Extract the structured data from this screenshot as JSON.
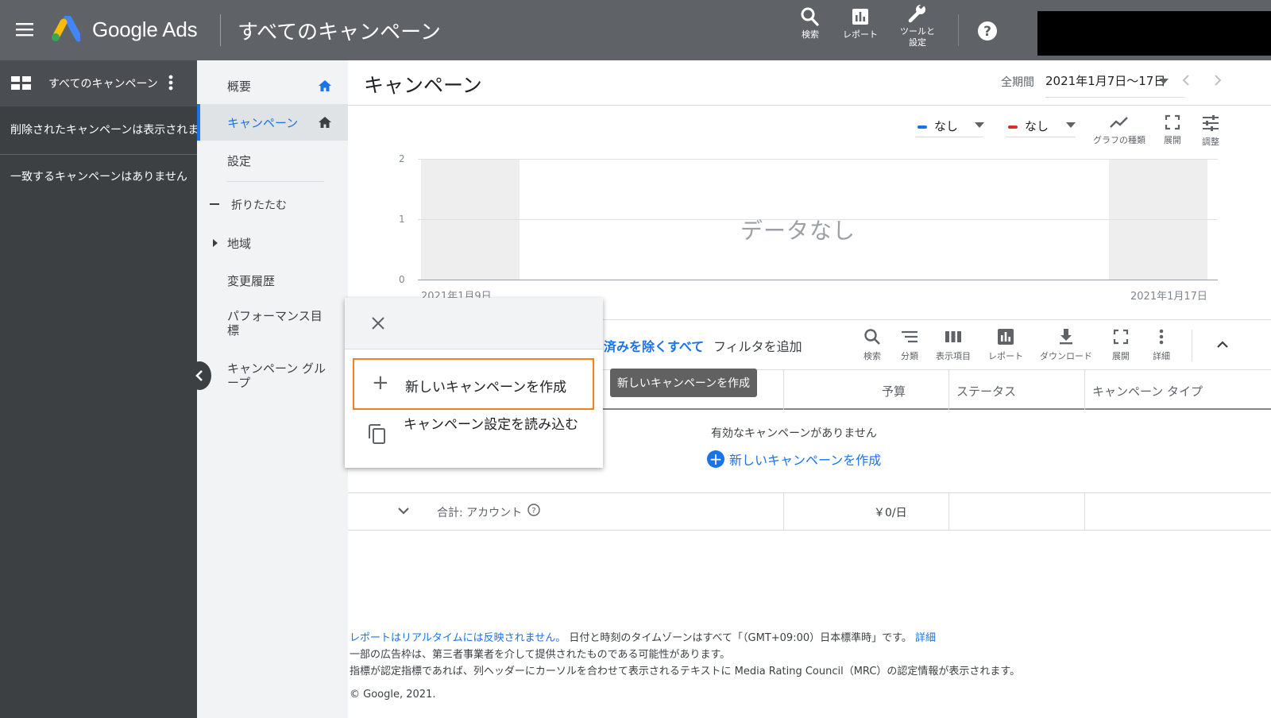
{
  "header": {
    "brand": "Google Ads",
    "title": "すべてのキャンペーン",
    "buttons": {
      "search": "検索",
      "report": "レポート",
      "tools_line1": "ツールと",
      "tools_line2": "設定"
    }
  },
  "left_panel": {
    "title": "すべてのキャンペーン",
    "deleted_note": "削除されたキャンペーンは表示されません",
    "no_match": "一致するキャンペーンはありません"
  },
  "nav": {
    "items": [
      {
        "label": "概要"
      },
      {
        "label": "キャンペーン"
      },
      {
        "label": "設定"
      },
      {
        "label": "折りたたむ"
      },
      {
        "label": "地域"
      },
      {
        "label": "変更履歴"
      },
      {
        "label": "パフォーマンス目標"
      },
      {
        "label": "キャンペーン グループ"
      }
    ]
  },
  "main": {
    "page_title": "キャンペーン",
    "date": {
      "label": "全期間",
      "value": "2021年1月7日～17日"
    },
    "chart": {
      "metric1": "なし",
      "metric2": "なし",
      "tools": {
        "type": "グラフの種類",
        "expand": "展開",
        "adjust": "調整"
      },
      "no_data": "データなし"
    },
    "table": {
      "filter_text": "済みを除くすべて",
      "add_filter": "フィルタを追加",
      "tools": {
        "search": "検索",
        "segment": "分類",
        "columns": "表示項目",
        "report": "レポート",
        "download": "ダウンロード",
        "expand": "展開",
        "more": "詳細"
      },
      "columns": [
        "予算",
        "ステータス",
        "キャンペーン タイプ"
      ],
      "empty_message": "有効なキャンペーンがありません",
      "create_link": "新しいキャンペーンを作成",
      "total_label": "合計: アカウント",
      "total_budget": "￥0/日"
    }
  },
  "tooltip": "新しいキャンペーンを作成",
  "popup": {
    "item_new": "新しいキャンペーンを作成",
    "item_load": "キャンペーン設定を読み込む"
  },
  "footer": {
    "line1_link": "レポートはリアルタイムには反映されません。",
    "line1_text": "日付と時刻のタイムゾーンはすべて「（GMT+09:00）日本標準時」です。",
    "line1_more": "詳細",
    "line2": "一部の広告枠は、第三者事業者を介して提供されたものである可能性があります。",
    "line3": "指標が認定指標であれば、列ヘッダーにカーソルを合わせて表示されるテキストに Media Rating Council（MRC）の認定情報が表示されます。",
    "copyright": "© Google, 2021."
  },
  "chart_data": {
    "type": "bar",
    "categories": [
      "2021年1月9日",
      "2021年1月17日"
    ],
    "series": [],
    "yticks": [
      0,
      1,
      2
    ],
    "ylim": [
      0,
      2
    ],
    "no_data_text": "データなし"
  }
}
